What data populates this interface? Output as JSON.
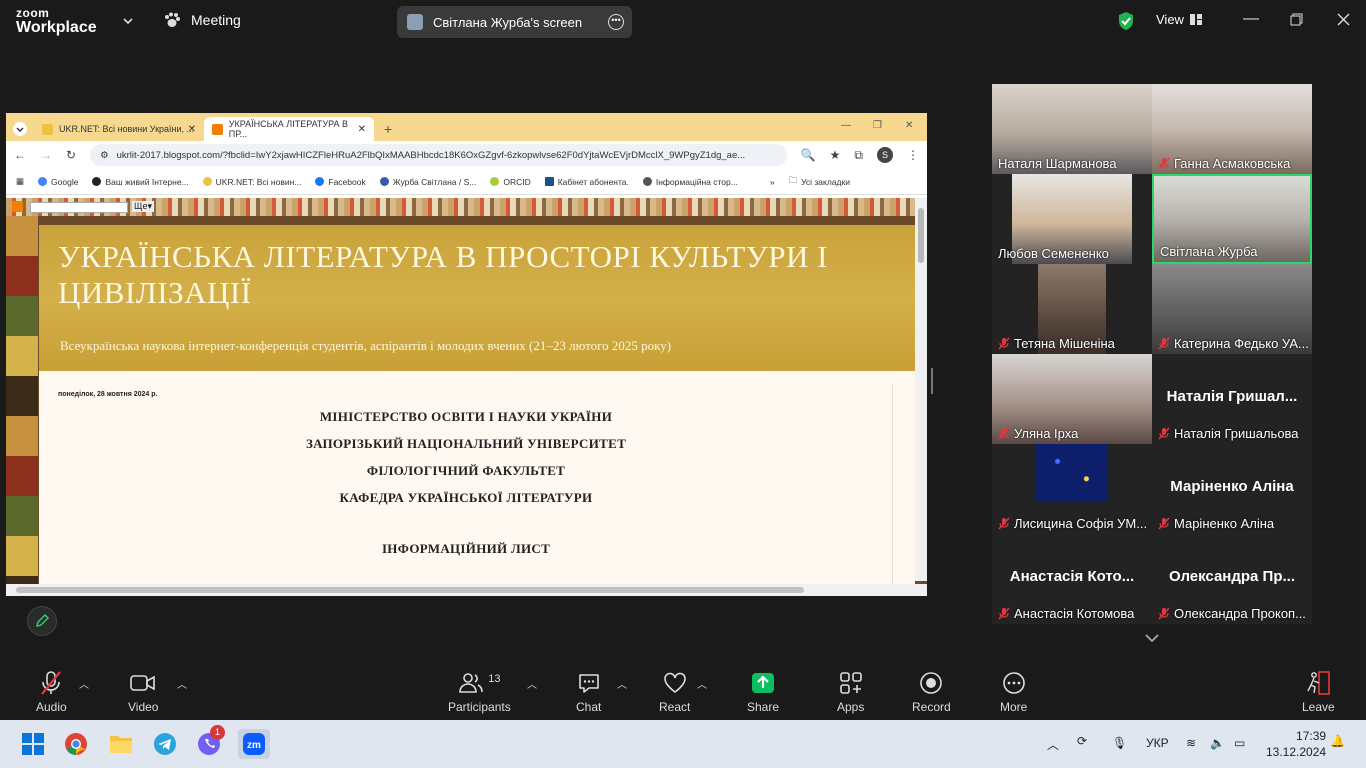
{
  "zoom": {
    "logo_top": "zoom",
    "logo_bottom": "Workplace",
    "meeting_label": "Meeting",
    "share_label": "Світлана Журба's screen",
    "view_label": "View"
  },
  "browser": {
    "tabs": [
      {
        "label": "UKR.NET: Всі новини України, ..."
      },
      {
        "label": "УКРАЇНСЬКА ЛІТЕРАТУРА В ПР..."
      }
    ],
    "url": "ukrlit-2017.blogspot.com/?fbclid=IwY2xjawHICZFleHRuA2FlbQIxMAABHbcdc18K6OxGZgvf-6zkopwlvse62F0dYjtaWcEVjrDMcclX_9WPgyZ1dg_ae...",
    "bookmarks": [
      "Google",
      "Ваш живий Інтерне...",
      "UKR.NET: Всі новин...",
      "Facebook",
      "Журба Світлана / S...",
      "ORCID",
      "Кабінет абонента.",
      "Інформаційна стор..."
    ],
    "all_bookmarks": "Усі закладки",
    "blog_more": "Ще▾"
  },
  "blog": {
    "title": "УКРАЇНСЬКА ЛІТЕРАТУРА В ПРОСТОРІ КУЛЬТУРИ І ЦИВІЛІЗАЦІЇ",
    "subtitle": "Всеукраїнська наукова інтернет-конференція студентів, аспірантів і молодих вчених (21–23 лютого 2025 року)",
    "date": "понеділок, 28 жовтня 2024 р.",
    "lines": [
      "МІНІСТЕРСТВО ОСВІТИ І НАУКИ УКРАЇНИ",
      "ЗАПОРІЗЬКИЙ НАЦІОНАЛЬНИЙ УНІВЕРСИТЕТ",
      "ФІЛОЛОГІЧНИЙ ФАКУЛЬТЕТ",
      "КАФЕДРА УКРАЇНСЬКОЇ ЛІТЕРАТУРИ",
      "ІНФОРМАЦІЙНИЙ ЛИСТ"
    ]
  },
  "participants": [
    {
      "name": "Наталя Шарманова",
      "muted": false,
      "video": true,
      "big": ""
    },
    {
      "name": "Ганна Асмаковська",
      "muted": true,
      "video": true,
      "big": ""
    },
    {
      "name": "Любов Семененко",
      "muted": false,
      "video": true,
      "big": ""
    },
    {
      "name": "Світлана Журба",
      "muted": false,
      "video": true,
      "big": "",
      "active": true
    },
    {
      "name": "Тетяна Мішеніна",
      "muted": true,
      "video": true,
      "big": ""
    },
    {
      "name": "Катерина Федько УА...",
      "muted": true,
      "video": true,
      "big": ""
    },
    {
      "name": "Уляна Ірха",
      "muted": true,
      "video": true,
      "big": ""
    },
    {
      "name": "Наталія Гришальова",
      "muted": true,
      "video": false,
      "big": "Наталія Гришал..."
    },
    {
      "name": "Лисицина Софія УМ...",
      "muted": true,
      "video": true,
      "big": ""
    },
    {
      "name": "Маріненко Аліна",
      "muted": true,
      "video": false,
      "big": "Маріненко Аліна"
    },
    {
      "name": "Анастасія Котомова",
      "muted": true,
      "video": false,
      "big": "Анастасія Кото..."
    },
    {
      "name": "Олександра Прокоп...",
      "muted": true,
      "video": false,
      "big": "Олександра Пр..."
    }
  ],
  "toolbar": {
    "audio": "Audio",
    "video": "Video",
    "participants": "Participants",
    "participants_count": "13",
    "chat": "Chat",
    "react": "React",
    "share": "Share",
    "apps": "Apps",
    "record": "Record",
    "more": "More",
    "leave": "Leave"
  },
  "taskbar": {
    "lang": "УКР",
    "time": "17:39",
    "date": "13.12.2024",
    "viber_badge": "1"
  },
  "colors": {
    "share_green": "#0bbe5f",
    "active_border": "#2bd66a",
    "mute_red": "#e0383e",
    "header_gold": "#c9a23a"
  }
}
